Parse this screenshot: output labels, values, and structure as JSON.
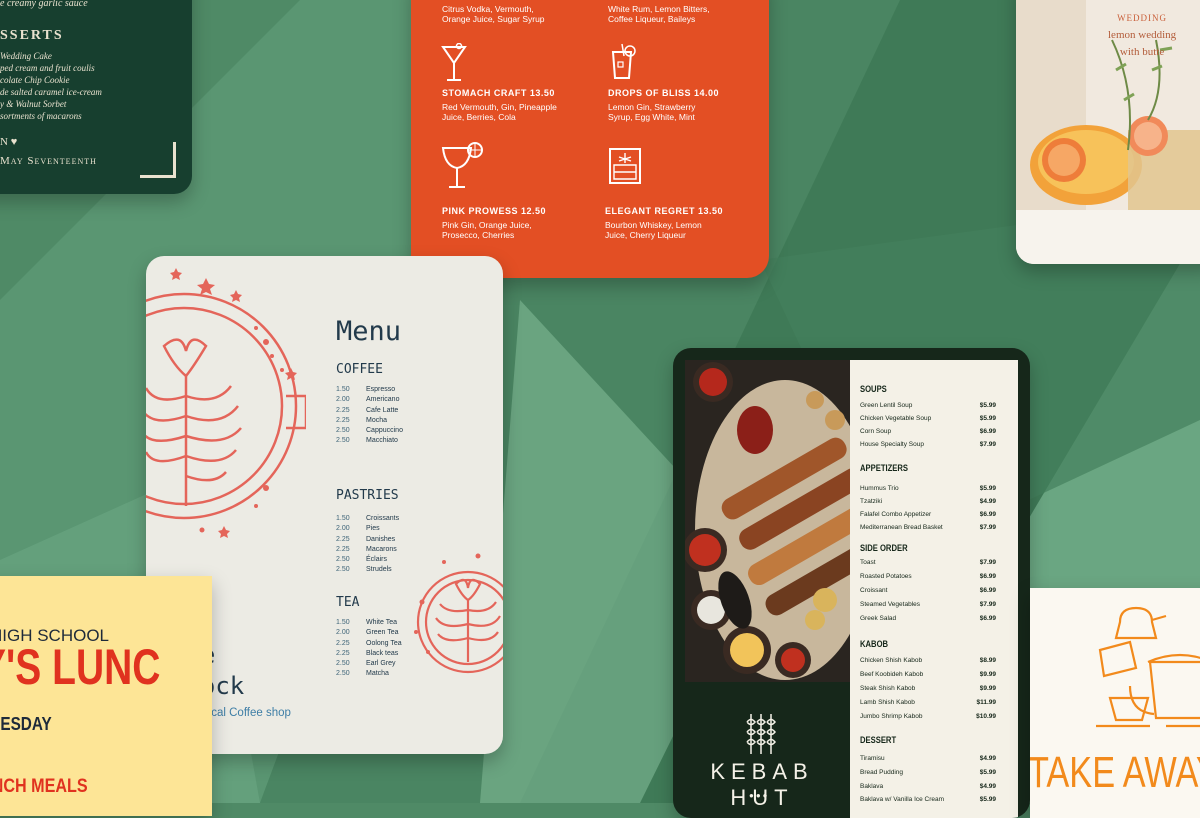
{
  "colors": {
    "background": "#4f8a66",
    "coffee_accent": "#e4655a",
    "cocktail_bg": "#e34f24",
    "kebab_dark": "#16271a",
    "lunch_bg": "#fde596",
    "takeaway_orange": "#f28a1c"
  },
  "wedding": {
    "partial_line": "e creamy garlic sauce",
    "section": "SSERTS",
    "items": [
      "Wedding Cake",
      "ped cream and fruit coulis",
      "colate Chip Cookie",
      "de salted caramel ice-cream",
      "y & Walnut Sorbet",
      "sortments of macarons"
    ],
    "signature": "N",
    "date": "May Seventeenth"
  },
  "cocktail": {
    "top_left": [
      "Citrus Vodka, Vermouth,",
      "Orange Juice, Sugar Syrup"
    ],
    "top_right": [
      "White Rum, Lemon Bitters,",
      "Coffee Liqueur, Baileys"
    ],
    "drinks": [
      {
        "name": "STOMACH CRAFT 13.50",
        "ingredients": [
          "Red Vermouth, Gin, Pineapple",
          "Juice, Berries, Cola"
        ],
        "icon": "martini-glass-icon"
      },
      {
        "name": "DROPS OF BLISS 14.00",
        "ingredients": [
          "Lemon Gin, Strawberry",
          "Syrup, Egg White, Mint"
        ],
        "icon": "highball-glass-icon"
      },
      {
        "name": "PINK PROWESS 12.50",
        "ingredients": [
          "Pink Gin, Orange Juice,",
          "Prosecco, Cherries"
        ],
        "icon": "margarita-glass-icon"
      },
      {
        "name": "ELEGANT REGRET 13.50",
        "ingredients": [
          "Bourbon Whiskey, Lemon",
          "Juice, Cherry Liqueur"
        ],
        "icon": "whiskey-glass-icon"
      }
    ]
  },
  "wedding_photo": {
    "line1": "WEDDING",
    "line2": "lemon wedding",
    "line3": "with butte"
  },
  "coffee": {
    "title": "Menu",
    "sections": [
      {
        "name": "COFFEE",
        "items": [
          [
            "1.50",
            "Espresso"
          ],
          [
            "2.00",
            "Americano"
          ],
          [
            "2.25",
            "Cafe Latte"
          ],
          [
            "2.25",
            "Mocha"
          ],
          [
            "2.50",
            "Cappuccino"
          ],
          [
            "2.50",
            "Macchiato"
          ]
        ]
      },
      {
        "name": "PASTRIES",
        "items": [
          [
            "1.50",
            "Croissants"
          ],
          [
            "2.00",
            "Pies"
          ],
          [
            "2.25",
            "Danishes"
          ],
          [
            "2.25",
            "Macarons"
          ],
          [
            "2.50",
            "Éclairs"
          ],
          [
            "2.50",
            "Strudels"
          ]
        ]
      },
      {
        "name": "TEA",
        "items": [
          [
            "1.50",
            "White Tea"
          ],
          [
            "2.00",
            "Green Tea"
          ],
          [
            "2.25",
            "Oolong Tea"
          ],
          [
            "2.25",
            "Black teas"
          ],
          [
            "2.50",
            "Earl Grey"
          ],
          [
            "2.50",
            "Matcha"
          ]
        ]
      }
    ],
    "brand_line1": "The",
    "brand_line2": "Block",
    "tagline": "Your Local Coffee shop"
  },
  "kebab": {
    "brand": "KEBAB HUT",
    "dots": "●●●",
    "sections": [
      {
        "name": "SOUPS",
        "items": [
          [
            "Green Lentil Soup",
            "$5.99"
          ],
          [
            "Chicken Vegetable Soup",
            "$5.99"
          ],
          [
            "Corn Soup",
            "$6.99"
          ],
          [
            "House Specialty Soup",
            "$7.99"
          ]
        ]
      },
      {
        "name": "APPETIZERS",
        "items": [
          [
            "Hummus Trio",
            "$5.99"
          ],
          [
            "Tzatziki",
            "$4.99"
          ],
          [
            "Falafel Combo Appetizer",
            "$6.99"
          ],
          [
            "Mediterranean Bread Basket",
            "$7.99"
          ]
        ]
      },
      {
        "name": "SIDE ORDER",
        "items": [
          [
            "Toast",
            "$7.99"
          ],
          [
            "Roasted Potatoes",
            "$6.99"
          ],
          [
            "Croissant",
            "$6.99"
          ],
          [
            "Steamed Vegetables",
            "$7.99"
          ],
          [
            "Greek Salad",
            "$6.99"
          ]
        ]
      },
      {
        "name": "KABOB",
        "items": [
          [
            "Chicken Shish Kabob",
            "$8.99"
          ],
          [
            "Beef Koobideh Kabob",
            "$9.99"
          ],
          [
            "Steak Shish Kabob",
            "$9.99"
          ],
          [
            "Lamb Shish Kabob",
            "$11.99"
          ],
          [
            "Jumbo Shrimp Kabob",
            "$10.99"
          ]
        ]
      },
      {
        "name": "DESSERT",
        "items": [
          [
            "Tiramisu",
            "$4.99"
          ],
          [
            "Bread Pudding",
            "$5.99"
          ],
          [
            "Baklava",
            "$4.99"
          ],
          [
            "Baklava w/ Vanilla Ice Cream",
            "$5.99"
          ]
        ]
      }
    ]
  },
  "lunch": {
    "school": "HIGH SCHOOL",
    "big": "Y'S LUNC",
    "day": "TUESDAY",
    "meals": "UNCH MEALS"
  },
  "takeaway": {
    "text": "TAKE AWAY"
  }
}
